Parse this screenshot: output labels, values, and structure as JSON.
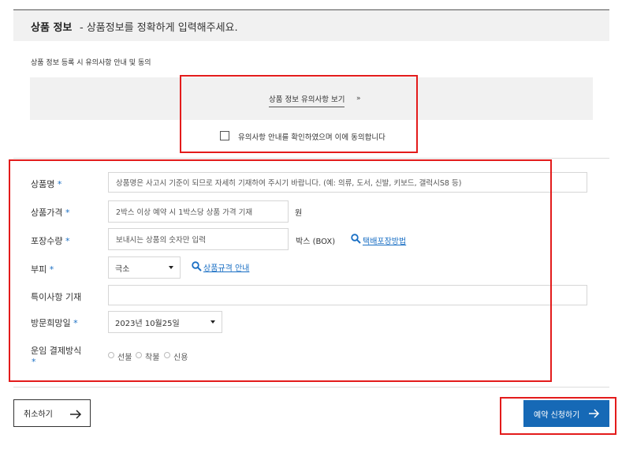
{
  "section": {
    "title": "상품 정보",
    "description": "- 상품정보를 정확하게 입력해주세요."
  },
  "notice": {
    "label": "상품 정보 등록 시 유의사항 안내 및 동의",
    "link_text": "상품 정보 유의사항 보기",
    "link_arrow": "»",
    "agree_text": "유의사항 안내를 확인하였으며 이에 동의합니다"
  },
  "form": {
    "required_mark": "*",
    "product_name": {
      "label": "상품명",
      "placeholder": "상품명은 사고시 기준이 되므로 자세히 기재하여 주시기 바랍니다. (예: 의류, 도서, 신발, 키보드, 갤럭시S8 등)"
    },
    "product_price": {
      "label": "상품가격",
      "placeholder": "2박스 이상 예약 시 1박스당 상품 가격 기재",
      "unit": "원"
    },
    "package_qty": {
      "label": "포장수량",
      "placeholder": "보내시는 상품의 숫자만 입력",
      "unit": "박스 (BOX)",
      "help_link": "택배포장방법"
    },
    "volume": {
      "label": "부피",
      "selected": "극소",
      "help_link": "상품규격 안내"
    },
    "notes": {
      "label": "특이사항 기재",
      "value": ""
    },
    "visit_date": {
      "label": "방문희망일",
      "selected": "2023년 10월25일"
    },
    "payment": {
      "label": "운임 결제방식",
      "options": [
        "선불",
        "착불",
        "신용"
      ]
    }
  },
  "buttons": {
    "cancel": "취소하기",
    "submit": "예약 신청하기"
  },
  "colors": {
    "accent": "#1669b6",
    "highlight_box": "#e31b1b",
    "required": "#1a6fc4"
  }
}
